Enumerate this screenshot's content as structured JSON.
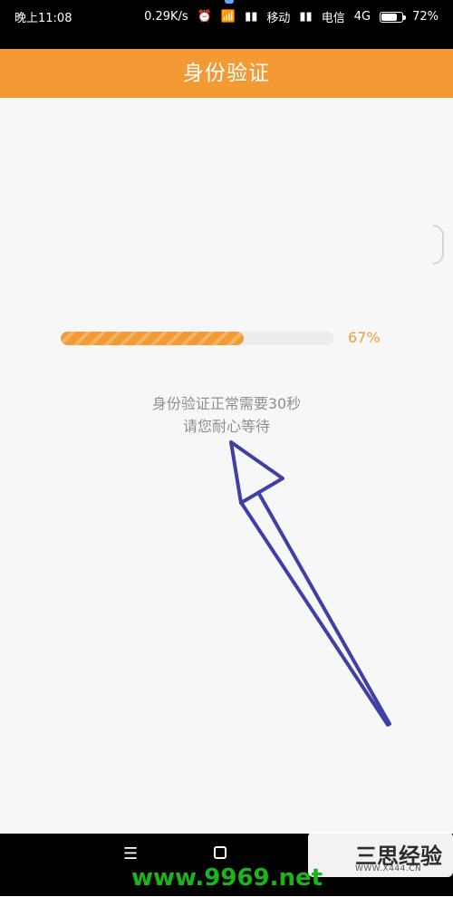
{
  "statusbar": {
    "time": "晚上11:08",
    "speed": "0.29K/s",
    "carrier1": "移动",
    "carrier2": "电信",
    "network": "4G",
    "battery": "72%",
    "battery_level": 0.72
  },
  "header": {
    "title": "身份验证"
  },
  "progress": {
    "percent_text": "67%",
    "value": 0.67
  },
  "message": {
    "line1": "身份验证正常需要30秒",
    "line2": "请您耐心等待"
  },
  "navbar": {
    "menu_icon": "menu-icon",
    "home_icon": "home-icon"
  },
  "watermark": {
    "brand": "三思经验",
    "sub": "WWW.X444.CN",
    "url": "www.9969.net"
  }
}
